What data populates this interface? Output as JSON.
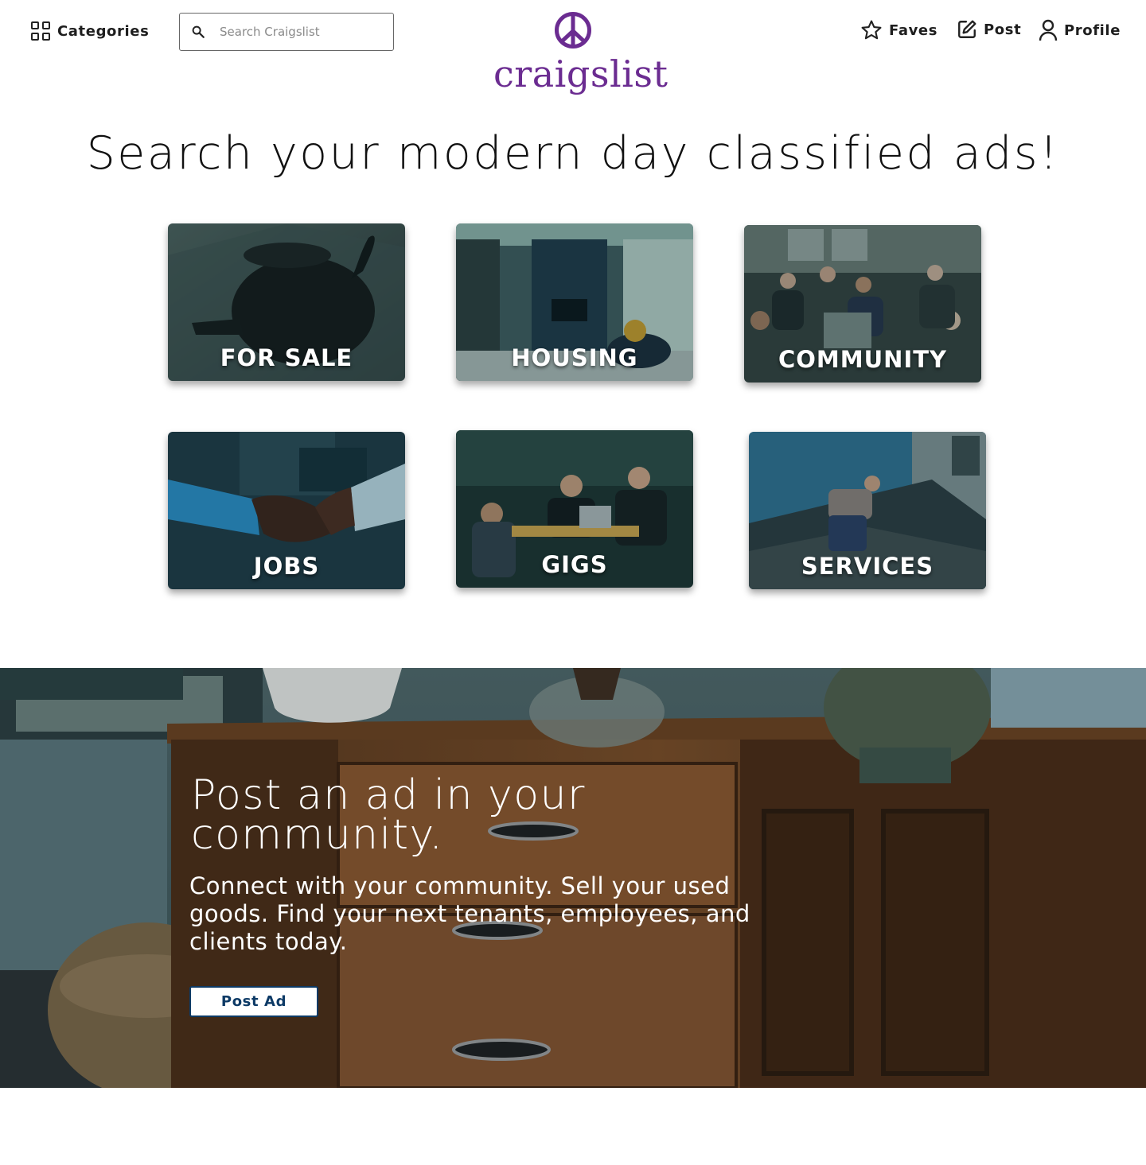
{
  "header": {
    "categories_label": "Categories",
    "search_placeholder": "Search Craigslist",
    "logo_text": "craigslist",
    "faves_label": "Faves",
    "post_label": "Post",
    "profile_label": "Profile",
    "brand_color": "#6b2c91",
    "icons": [
      "grid-icon",
      "search-icon",
      "peace-icon",
      "star-icon",
      "edit-icon",
      "user-icon"
    ]
  },
  "main": {
    "headline": "Search your modern day classified ads!",
    "categories": [
      {
        "label": "FOR SALE",
        "image": "teapot"
      },
      {
        "label": "HOUSING",
        "image": "living-room"
      },
      {
        "label": "COMMUNITY",
        "image": "group-meeting"
      },
      {
        "label": "JOBS",
        "image": "handshake"
      },
      {
        "label": "GIGS",
        "image": "cafe-laptops"
      },
      {
        "label": "SERVICES",
        "image": "roofer"
      }
    ]
  },
  "promo": {
    "title": "Post an ad in your community.",
    "text": "Connect with your community. Sell your used goods. Find your next tenants, employees, and clients today.",
    "button_label": "Post Ad",
    "button_color": "#0d3a66",
    "background": "wooden-dresser"
  }
}
